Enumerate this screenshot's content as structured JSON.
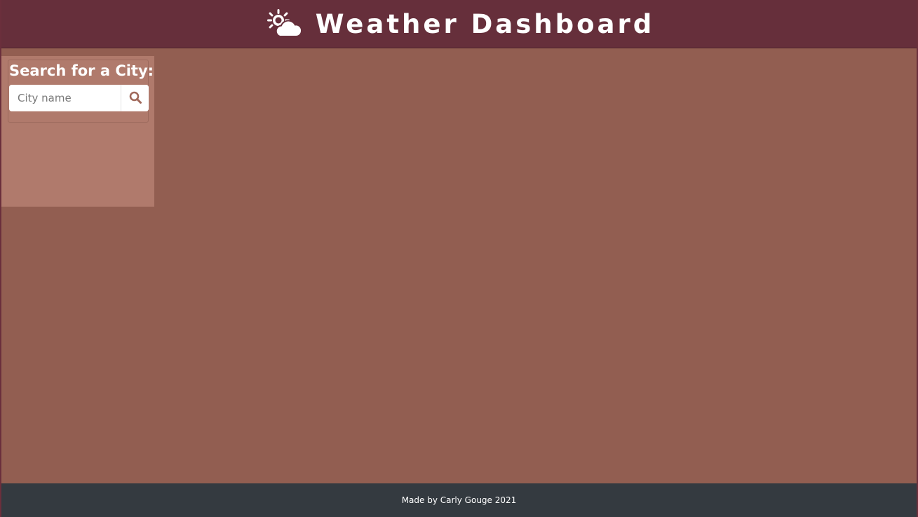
{
  "header": {
    "title": "Weather Dashboard",
    "icon": "sun-cloud-icon"
  },
  "sidebar": {
    "heading": "Search for a City:",
    "search": {
      "placeholder": "City name",
      "value": "",
      "button_icon": "search-icon"
    }
  },
  "footer": {
    "text": "Made by Carly Gouge 2021"
  },
  "colors": {
    "header_bg": "#662f3b",
    "page_bg": "#925e51",
    "sidebar_bg": "#b07a6c",
    "footer_bg": "#343a40",
    "search_icon": "#a0685a"
  }
}
